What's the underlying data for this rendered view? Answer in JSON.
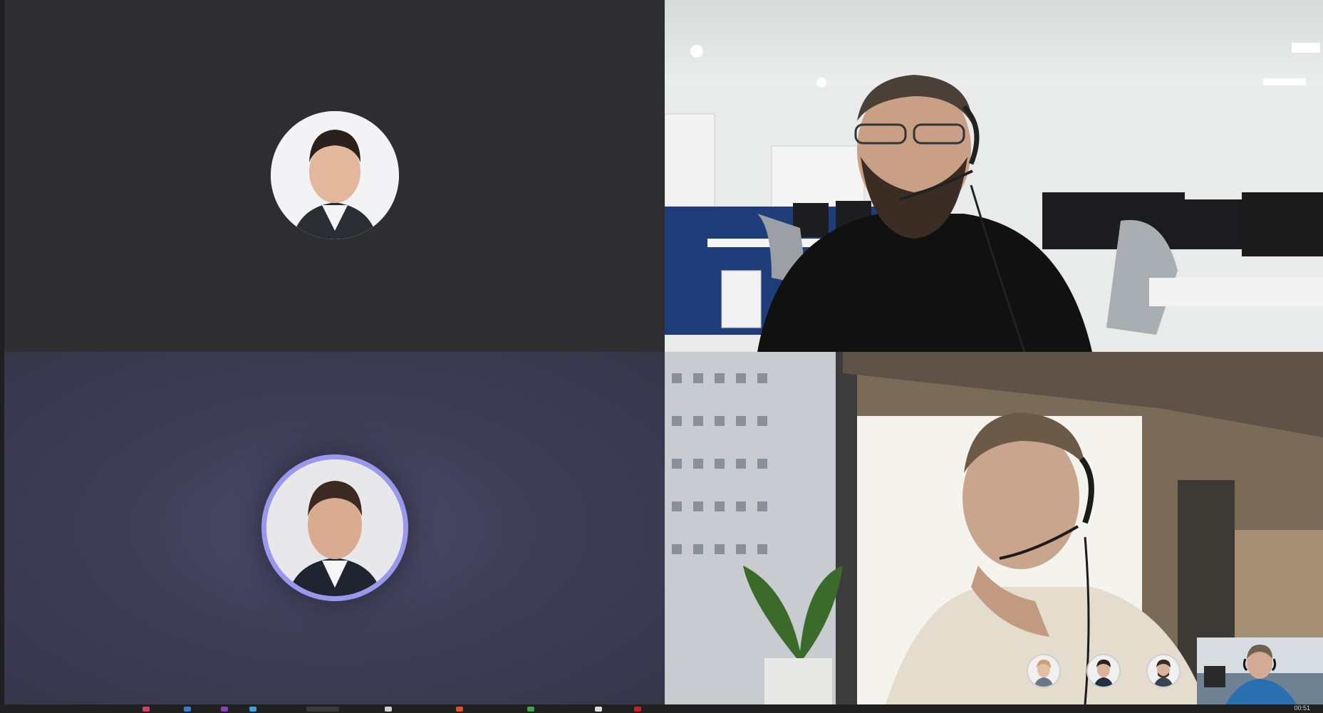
{
  "meeting": {
    "participants": [
      {
        "id": "p1",
        "display": "avatar",
        "photo": "man-in-suit-white-background"
      },
      {
        "id": "p2",
        "display": "video",
        "scene": "man-with-headset-in-open-office"
      },
      {
        "id": "p3",
        "display": "avatar",
        "photo": "man-in-suit-light-background",
        "speaking_ring_color": "#9a98ec"
      },
      {
        "id": "p4",
        "display": "video",
        "scene": "man-with-headset-by-window"
      }
    ],
    "overflow_participants": [
      {
        "id": "o1",
        "photo": "woman-avatar"
      },
      {
        "id": "o2",
        "photo": "man-avatar"
      },
      {
        "id": "o3",
        "photo": "man-with-beard-avatar"
      }
    ],
    "self_view": {
      "scene": "self-camera-preview"
    }
  },
  "taskbar": {
    "clock": "00:51"
  },
  "colors": {
    "tile_dark": "#2e2d30",
    "tile_purple": "#403f58",
    "speaking_ring": "#9a98ec"
  }
}
